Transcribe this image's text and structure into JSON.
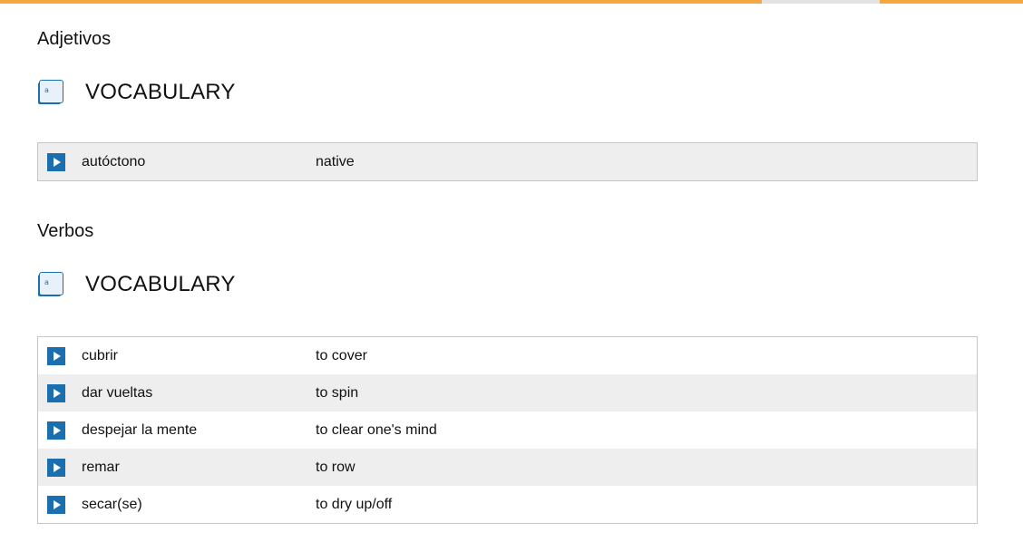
{
  "colors": {
    "accent_orange": "#f5a742",
    "divider_gray": "#e3e3e3",
    "play_button_blue": "#1c6fae",
    "row_shade": "#efeeee"
  },
  "sections": [
    {
      "title": "Adjetivos",
      "vocab_label": "VOCABULARY",
      "icon": "book-icon",
      "items": [
        {
          "term": "autóctono",
          "meaning": "native"
        }
      ]
    },
    {
      "title": "Verbos",
      "vocab_label": "VOCABULARY",
      "icon": "book-icon",
      "items": [
        {
          "term": "cubrir",
          "meaning": "to cover"
        },
        {
          "term": "dar vueltas",
          "meaning": "to spin"
        },
        {
          "term": "despejar la mente",
          "meaning": "to clear one's mind"
        },
        {
          "term": "remar",
          "meaning": "to row"
        },
        {
          "term": "secar(se)",
          "meaning": "to dry up/off"
        }
      ]
    }
  ]
}
